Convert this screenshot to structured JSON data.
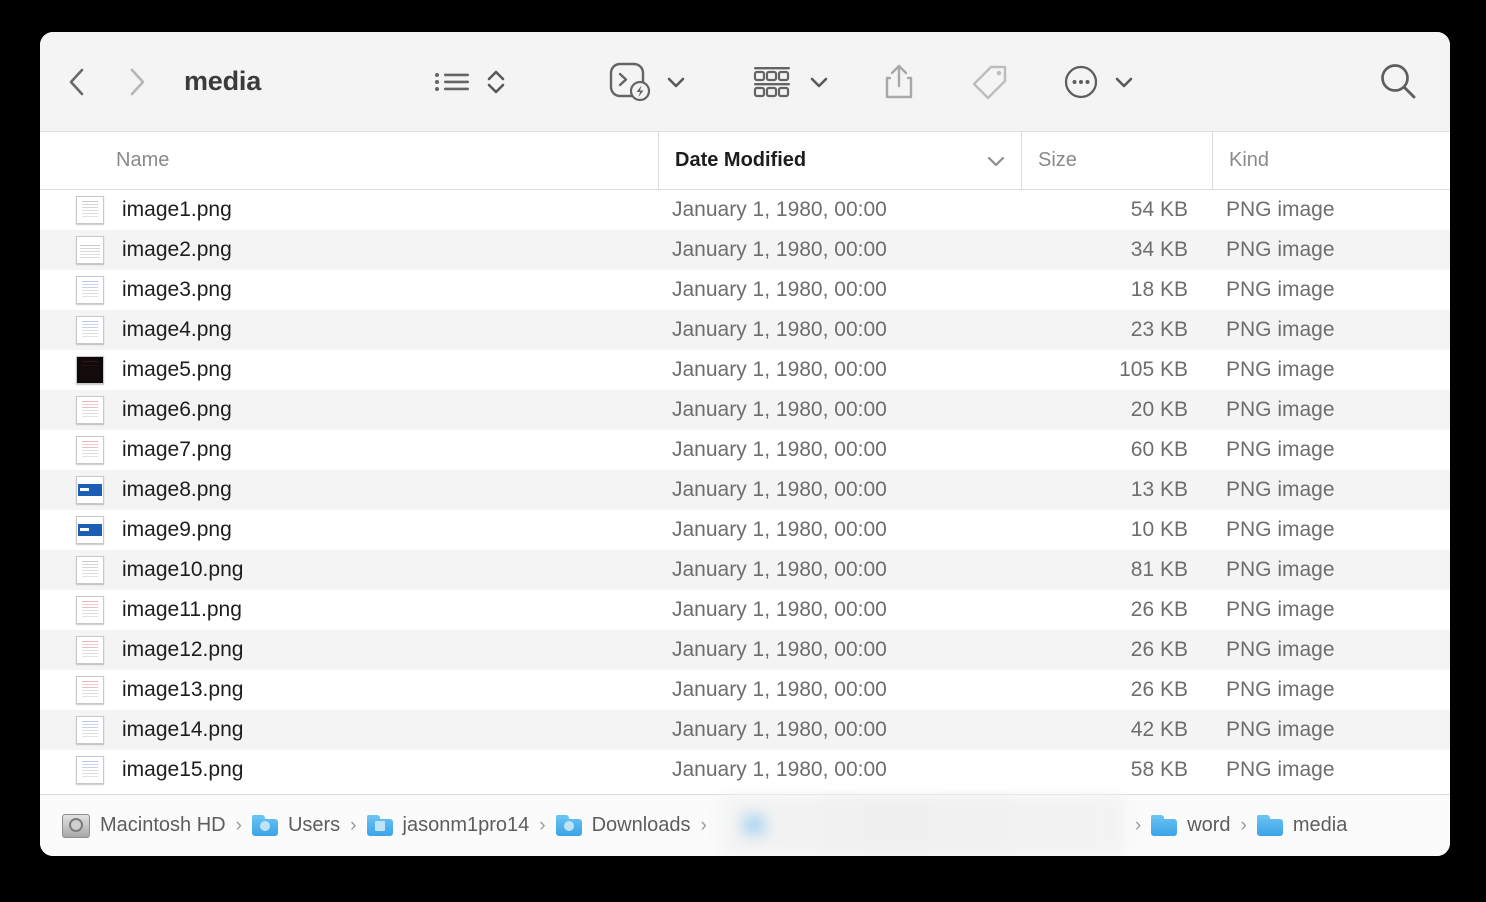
{
  "window": {
    "title": "media"
  },
  "toolbar": {
    "back_label": "Back",
    "forward_label": "Forward",
    "view_list_label": "List View",
    "view_arrange_label": "Arrange",
    "quick_actions_label": "Quick Actions",
    "group_label": "Group",
    "share_label": "Share",
    "tags_label": "Tags",
    "more_label": "More",
    "search_label": "Search"
  },
  "columns": [
    {
      "key": "name",
      "label": "Name",
      "sorted": false
    },
    {
      "key": "date",
      "label": "Date Modified",
      "sorted": true
    },
    {
      "key": "size",
      "label": "Size",
      "sorted": false
    },
    {
      "key": "kind",
      "label": "Kind",
      "sorted": false
    }
  ],
  "files": [
    {
      "name": "image1.png",
      "date": "January 1, 1980, 00:00",
      "size": "54 KB",
      "kind": "PNG image",
      "thumb": "doc"
    },
    {
      "name": "image2.png",
      "date": "January 1, 1980, 00:00",
      "size": "34 KB",
      "kind": "PNG image",
      "thumb": "wide"
    },
    {
      "name": "image3.png",
      "date": "January 1, 1980, 00:00",
      "size": "18 KB",
      "kind": "PNG image",
      "thumb": "doc-blue"
    },
    {
      "name": "image4.png",
      "date": "January 1, 1980, 00:00",
      "size": "23 KB",
      "kind": "PNG image",
      "thumb": "doc-blue"
    },
    {
      "name": "image5.png",
      "date": "January 1, 1980, 00:00",
      "size": "105 KB",
      "kind": "PNG image",
      "thumb": "dark"
    },
    {
      "name": "image6.png",
      "date": "January 1, 1980, 00:00",
      "size": "20 KB",
      "kind": "PNG image",
      "thumb": "doc-red"
    },
    {
      "name": "image7.png",
      "date": "January 1, 1980, 00:00",
      "size": "60 KB",
      "kind": "PNG image",
      "thumb": "doc-red"
    },
    {
      "name": "image8.png",
      "date": "January 1, 1980, 00:00",
      "size": "13 KB",
      "kind": "PNG image",
      "thumb": "banner"
    },
    {
      "name": "image9.png",
      "date": "January 1, 1980, 00:00",
      "size": "10 KB",
      "kind": "PNG image",
      "thumb": "banner"
    },
    {
      "name": "image10.png",
      "date": "January 1, 1980, 00:00",
      "size": "81 KB",
      "kind": "PNG image",
      "thumb": "doc"
    },
    {
      "name": "image11.png",
      "date": "January 1, 1980, 00:00",
      "size": "26 KB",
      "kind": "PNG image",
      "thumb": "doc-red"
    },
    {
      "name": "image12.png",
      "date": "January 1, 1980, 00:00",
      "size": "26 KB",
      "kind": "PNG image",
      "thumb": "doc-red"
    },
    {
      "name": "image13.png",
      "date": "January 1, 1980, 00:00",
      "size": "26 KB",
      "kind": "PNG image",
      "thumb": "doc-red"
    },
    {
      "name": "image14.png",
      "date": "January 1, 1980, 00:00",
      "size": "42 KB",
      "kind": "PNG image",
      "thumb": "doc-blue"
    },
    {
      "name": "image15.png",
      "date": "January 1, 1980, 00:00",
      "size": "58 KB",
      "kind": "PNG image",
      "thumb": "doc-blue"
    }
  ],
  "path_bar": {
    "separator": "›",
    "crumbs": [
      {
        "label": "Macintosh HD",
        "icon": "hard-disk"
      },
      {
        "label": "Users",
        "icon": "folder-users"
      },
      {
        "label": "jasonm1pro14",
        "icon": "folder-home"
      },
      {
        "label": "Downloads",
        "icon": "folder-downloads"
      },
      {
        "label": "",
        "icon": "redacted"
      },
      {
        "label": "word",
        "icon": "folder-plain"
      },
      {
        "label": "media",
        "icon": "folder-plain"
      }
    ]
  },
  "colors": {
    "toolbar_bg": "#f4f4f4",
    "row_alt_bg": "#f4f4f4",
    "text_primary": "#1d1d1d",
    "text_secondary": "#6e6e6e",
    "folder_blue": "#3ba4e8",
    "desktop_bg": "#000000"
  }
}
